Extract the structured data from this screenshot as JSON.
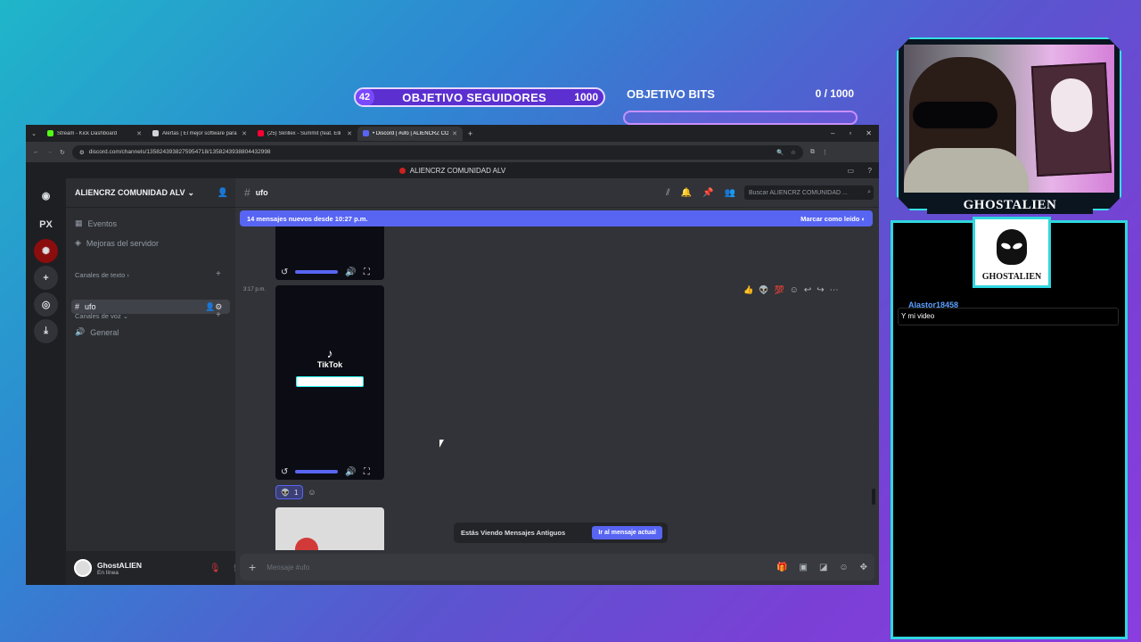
{
  "goals": {
    "followers_current": "42",
    "followers_label": "OBJETIVO SEGUIDORES",
    "followers_target": "1000",
    "bits_label": "OBJETIVO BITS",
    "bits_count": "0 / 1000"
  },
  "stream": {
    "cam_name": "GHOSTALIEN",
    "badge_name": "GHOSTALIEN",
    "chat_user": "Alastor18458",
    "chat_message": "Y mi video"
  },
  "browser": {
    "tabs": [
      {
        "title": "Stream - Kick Dashboard",
        "color": "#53fc18"
      },
      {
        "title": "Alertas | El mejor software para",
        "color": "#cfd2d6"
      },
      {
        "title": "(25) Skrillex - Summit (feat. Elli",
        "color": "#ff0033"
      },
      {
        "title": "• Discord | #ufo | ALIENCRZ CO",
        "color": "#5865f2"
      }
    ],
    "url": "discord.com/channels/1358243938275954718/1358243938804432998"
  },
  "discord": {
    "window_title": "ALIENCRZ COMUNIDAD ALV",
    "rail_px": "PX",
    "server_name": "ALIENCRZ COMUNIDAD ALV",
    "channel_events": "Eventos",
    "channel_boosts": "Mejoras del servidor",
    "cat_text": "Canales de texto",
    "channel_ufo": "ufo",
    "cat_voice": "Canales de voz",
    "channel_general": "General",
    "username": "GhostALIEN",
    "status": "En línea",
    "header_channel": "ufo",
    "search_placeholder": "Buscar ALIENCRZ COMUNIDAD ...",
    "new_messages": "14 mensajes nuevos desde 10:27 p.m.",
    "mark_read": "Marcar como leído",
    "timestamp": "3:17 p.m.",
    "tiktok_label": "TikTok",
    "reaction_count": "1",
    "old_messages_text": "Estás Viendo Mensajes Antiguos",
    "jump_button": "Ir al mensaje actual",
    "composer_placeholder": "Mensaje #ufo",
    "accent": "#5865f2"
  }
}
